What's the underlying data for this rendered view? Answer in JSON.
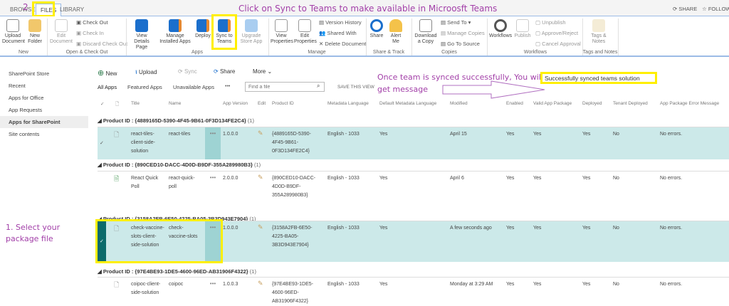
{
  "tabs": [
    {
      "label": "BROWSE"
    },
    {
      "label": "FILES"
    },
    {
      "label": "LIBRARY"
    }
  ],
  "top_actions": {
    "share": "SHARE",
    "follow": "FOLLOW"
  },
  "annotations": {
    "step2": "2",
    "title": "Click on Sync to Teams to make available in Microosft Teams",
    "synced": "Once team is synced successfully, You will get message",
    "step1": "1. Select your package file"
  },
  "ribbon": {
    "new": {
      "upload": "Upload Document",
      "folder": "New Folder",
      "label": "New"
    },
    "checkout": {
      "edit": "Edit Document",
      "check_out": "Check Out",
      "check_in": "Check In",
      "discard": "Discard Check Out",
      "label": "Open & Check Out"
    },
    "apps": {
      "view": "View Details Page",
      "manage": "Manage Installed Apps",
      "deploy": "Deploy",
      "sync": "Sync to Teams",
      "upgrade": "Upgrade Store App",
      "label": "Apps"
    },
    "manage": {
      "view_props": "View Properties",
      "edit_props": "Edit Properties",
      "version": "Version History",
      "shared": "Shared With",
      "delete": "Delete Document",
      "label": "Manage"
    },
    "share": {
      "share": "Share",
      "alert": "Alert Me",
      "label": "Share & Track"
    },
    "copies": {
      "download": "Download a Copy",
      "send": "Send To",
      "manage": "Manage Copies",
      "source": "Go To Source",
      "label": "Copies"
    },
    "workflows": {
      "wf": "Workflows",
      "publish": "Publish",
      "unpublish": "Unpublish",
      "approve": "Approve/Reject",
      "cancel": "Cancel Approval",
      "label": "Workflows"
    },
    "tags": {
      "tags": "Tags & Notes",
      "label": "Tags and Notes"
    }
  },
  "nav": [
    "SharePoint Store",
    "Recent",
    "Apps for Office",
    "App Requests",
    "Apps for SharePoint",
    "Site contents"
  ],
  "commands": {
    "new": "New",
    "upload": "Upload",
    "sync": "Sync",
    "share": "Share",
    "more": "More"
  },
  "views": {
    "all": "All Apps",
    "featured": "Featured Apps",
    "unavailable": "Unavailable Apps",
    "more": "•••",
    "search_placeholder": "Find a file",
    "save": "SAVE THIS VIEW"
  },
  "status_message": "Successfully synced teams solution",
  "columns": [
    "Title",
    "Name",
    "App Version",
    "Edit",
    "Product ID",
    "Metadata Language",
    "Default Metadata Language",
    "Modified",
    "Enabled",
    "Valid App Package",
    "Deployed",
    "Tenant Deployed",
    "App Package Error Message"
  ],
  "groups": [
    {
      "header": "Product ID : {4889165D-5390-4F45-9B61-0F3D134FE2C4}",
      "count": "(1)",
      "selected": true,
      "row": {
        "title": "react-tiles-client-side-solution",
        "name": "react-tiles",
        "version": "1.0.0.0",
        "pid": "{4889165D-5390-4F45-9B61-0F3D134FE2C4}",
        "lang": "English - 1033",
        "def": "Yes",
        "modified": "April 15",
        "enabled": "Yes",
        "valid": "Yes",
        "deployed": "Yes",
        "tenant": "No",
        "error": "No errors."
      }
    },
    {
      "header": "Product ID : {890CED10-DACC-4D0D-B9DF-355A289980B3}",
      "count": "(1)",
      "selected": false,
      "row": {
        "title": "React Quick Poll",
        "name": "react-quick-poll",
        "version": "2.0.0.0",
        "pid": "{890CED10-DACC-4D0D-B9DF-355A289980B3}",
        "lang": "English - 1033",
        "def": "Yes",
        "modified": "April 6",
        "enabled": "Yes",
        "valid": "Yes",
        "deployed": "Yes",
        "tenant": "No",
        "error": "No errors."
      }
    },
    {
      "header": "Product ID : {3158A2FB-6E50-4225-BA05-3B3D943E7904}",
      "count": "(1)",
      "selected": true,
      "row": {
        "title": "check-vaccine-slots-client-side-solution",
        "name": "check-vaccine-slots",
        "version": "1.0.0.0",
        "pid": "{3158A2FB-6E50-4225-BA05-3B3D943E7904}",
        "lang": "English - 1033",
        "def": "Yes",
        "modified": "A few seconds ago",
        "enabled": "Yes",
        "valid": "Yes",
        "deployed": "Yes",
        "tenant": "No",
        "error": "No errors."
      }
    },
    {
      "header": "Product ID : {97E4BE93-1DE5-4600-96ED-AB31906F4322}",
      "count": "(1)",
      "selected": false,
      "row": {
        "title": "coipoc-client-side-solution",
        "name": "coipoc",
        "version": "1.0.0.3",
        "pid": "{97E4BE93-1DE5-4600-96ED-AB31906F4322}",
        "lang": "English - 1033",
        "def": "Yes",
        "modified": "Monday at 3:29 AM",
        "enabled": "Yes",
        "valid": "Yes",
        "deployed": "Yes",
        "tenant": "No",
        "error": "No errors."
      }
    }
  ]
}
